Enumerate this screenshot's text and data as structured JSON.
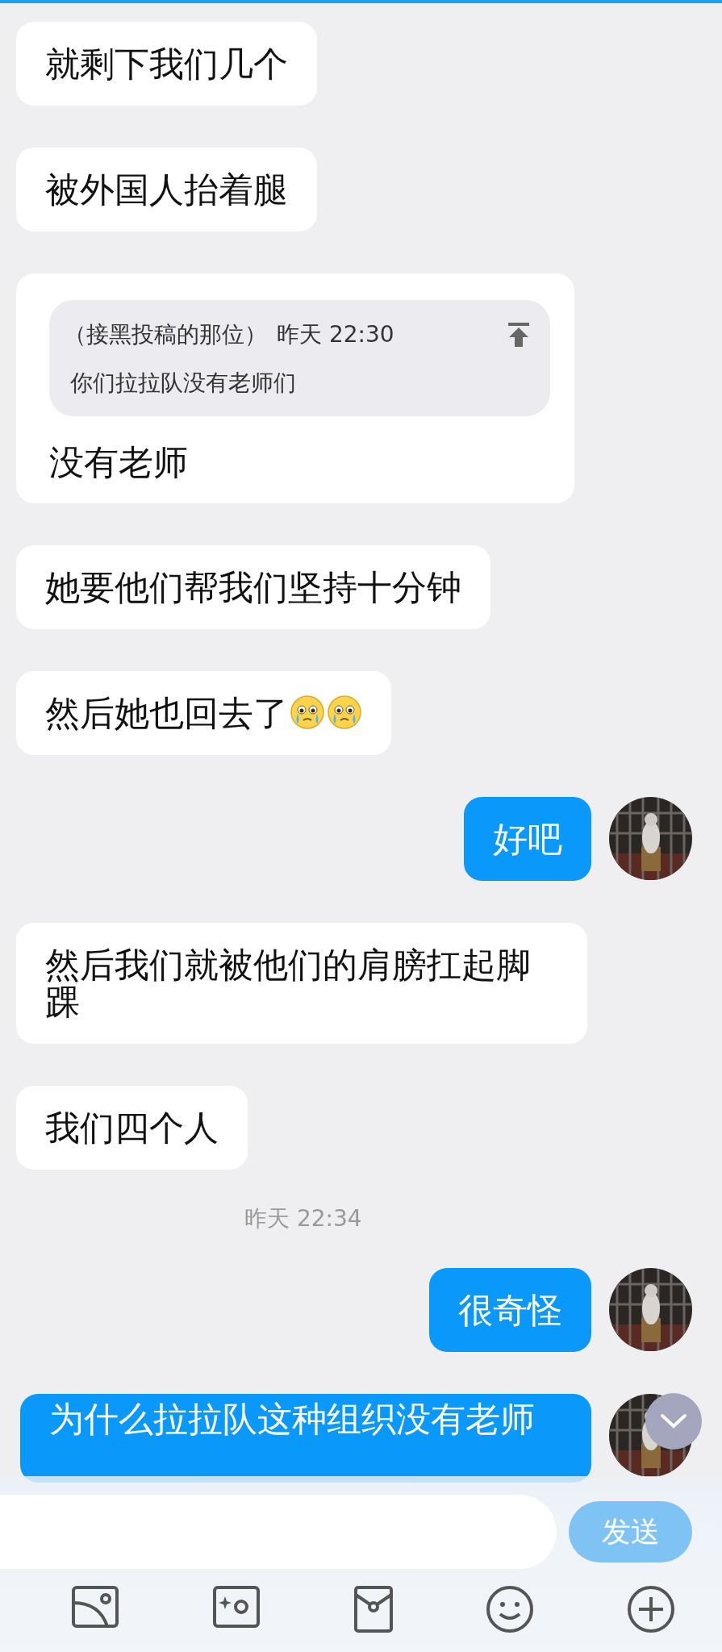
{
  "messages": [
    {
      "kind": "incoming",
      "text": "就剩下我们几个"
    },
    {
      "kind": "incoming",
      "text": "被外国人抬着腿"
    },
    {
      "kind": "incoming",
      "quote": {
        "author": "（接黑投稿的那位）",
        "time": "昨天 22:30",
        "text": "你们拉拉队没有老师们"
      },
      "text": "没有老师"
    },
    {
      "kind": "incoming",
      "text": "她要他们帮我们坚持十分钟"
    },
    {
      "kind": "incoming",
      "text": "然后她也回去了",
      "emojis": [
        {
          "kind": "crying"
        },
        {
          "kind": "crying"
        }
      ]
    },
    {
      "kind": "outgoing",
      "text": "好吧"
    },
    {
      "kind": "incoming",
      "text": "然后我们就被他们的肩膀扛起脚踝"
    },
    {
      "kind": "incoming",
      "text": "我们四个人"
    },
    {
      "kind": "timestamp",
      "text": "昨天 22:34"
    },
    {
      "kind": "outgoing",
      "text": "很奇怪"
    },
    {
      "kind": "outgoing",
      "text": "为什么拉拉队这种组织没有老师",
      "clipped": true
    }
  ],
  "composer": {
    "send_button": "发送"
  }
}
